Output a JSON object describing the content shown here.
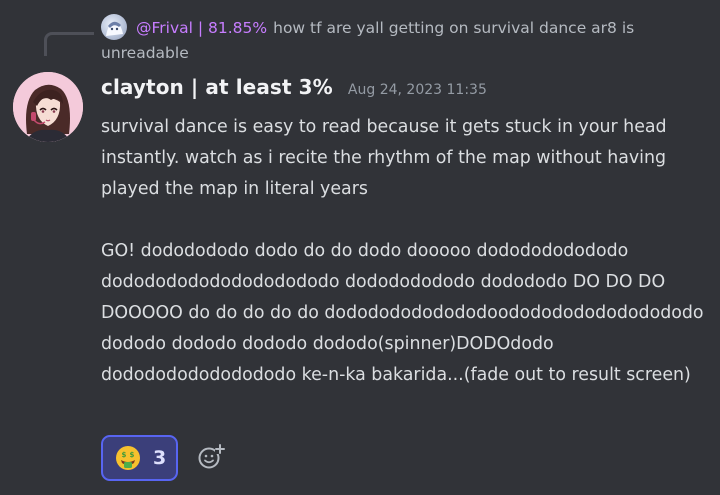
{
  "reply": {
    "author": "@Frival | 81.85%",
    "text": "how tf are yall getting on survival dance ar8 is unreadable"
  },
  "message": {
    "username": "clayton | at least 3%",
    "timestamp": "Aug 24, 2023 11:35",
    "paragraph1": "survival dance is easy to read because it gets stuck in your head instantly. watch as i recite the rhythm of the map without having played the map in literal years",
    "paragraph2": "GO! dododododo dodo do do dodo dooooo dododododododo dododododododododododo dodododododo dodododo DO DO DO DOOOOO do do do do do dodododododododoodododododododododo dododo dododo dododo dododo(spinner)DODOdodo dododododododododo ke-n-ka bakarida...(fade out to result screen)"
  },
  "reactions": [
    {
      "emoji": "money-mouth-face-icon",
      "count": "3"
    }
  ],
  "colors": {
    "background": "#313338",
    "reply_author": "#c77dff",
    "reaction_bg": "#3b3f7a",
    "reaction_border": "#5865f2"
  }
}
